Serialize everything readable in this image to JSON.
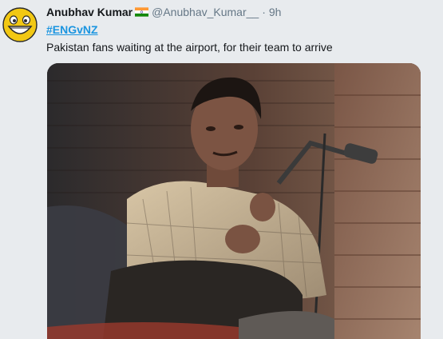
{
  "tweet": {
    "author": {
      "display_name": "Anubhav Kumar",
      "handle": "@Anubhav_Kumar__",
      "avatar_icon": "grinning-face-icon",
      "flag_icon": "india-flag-icon"
    },
    "separator": "·",
    "timestamp": "9h",
    "hashtag": "#ENGvNZ",
    "text": "Pakistan fans waiting at the airport, for their team to arrive",
    "media_icon": "photo-man-crouching-by-brick-wall"
  },
  "colors": {
    "background": "#e8ebee",
    "link": "#1b95e0",
    "text": "#14171a",
    "muted": "#657786"
  }
}
